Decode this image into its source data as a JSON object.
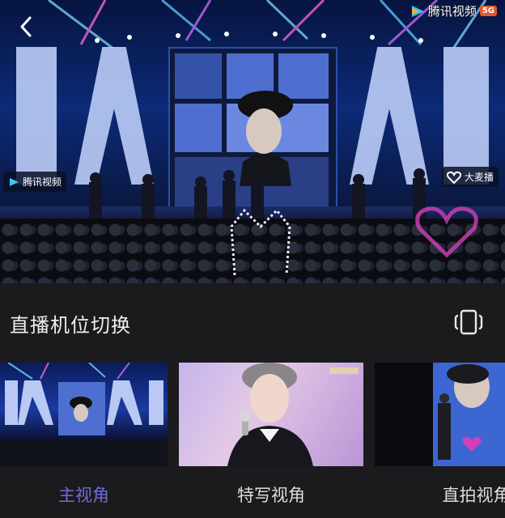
{
  "player": {
    "watermark": {
      "text": "腾讯视频",
      "badge": "5G"
    },
    "left_badge": "腾讯视频",
    "right_badge": "大麦播",
    "stage_text": "A!"
  },
  "switch_section": {
    "title": "直播机位切换"
  },
  "cameras": [
    {
      "label": "主视角",
      "active": true
    },
    {
      "label": "特写视角",
      "active": false
    },
    {
      "label": "直拍视角",
      "active": false
    }
  ],
  "colors": {
    "active": "#6f6bd8",
    "background": "#1b1b1d"
  }
}
